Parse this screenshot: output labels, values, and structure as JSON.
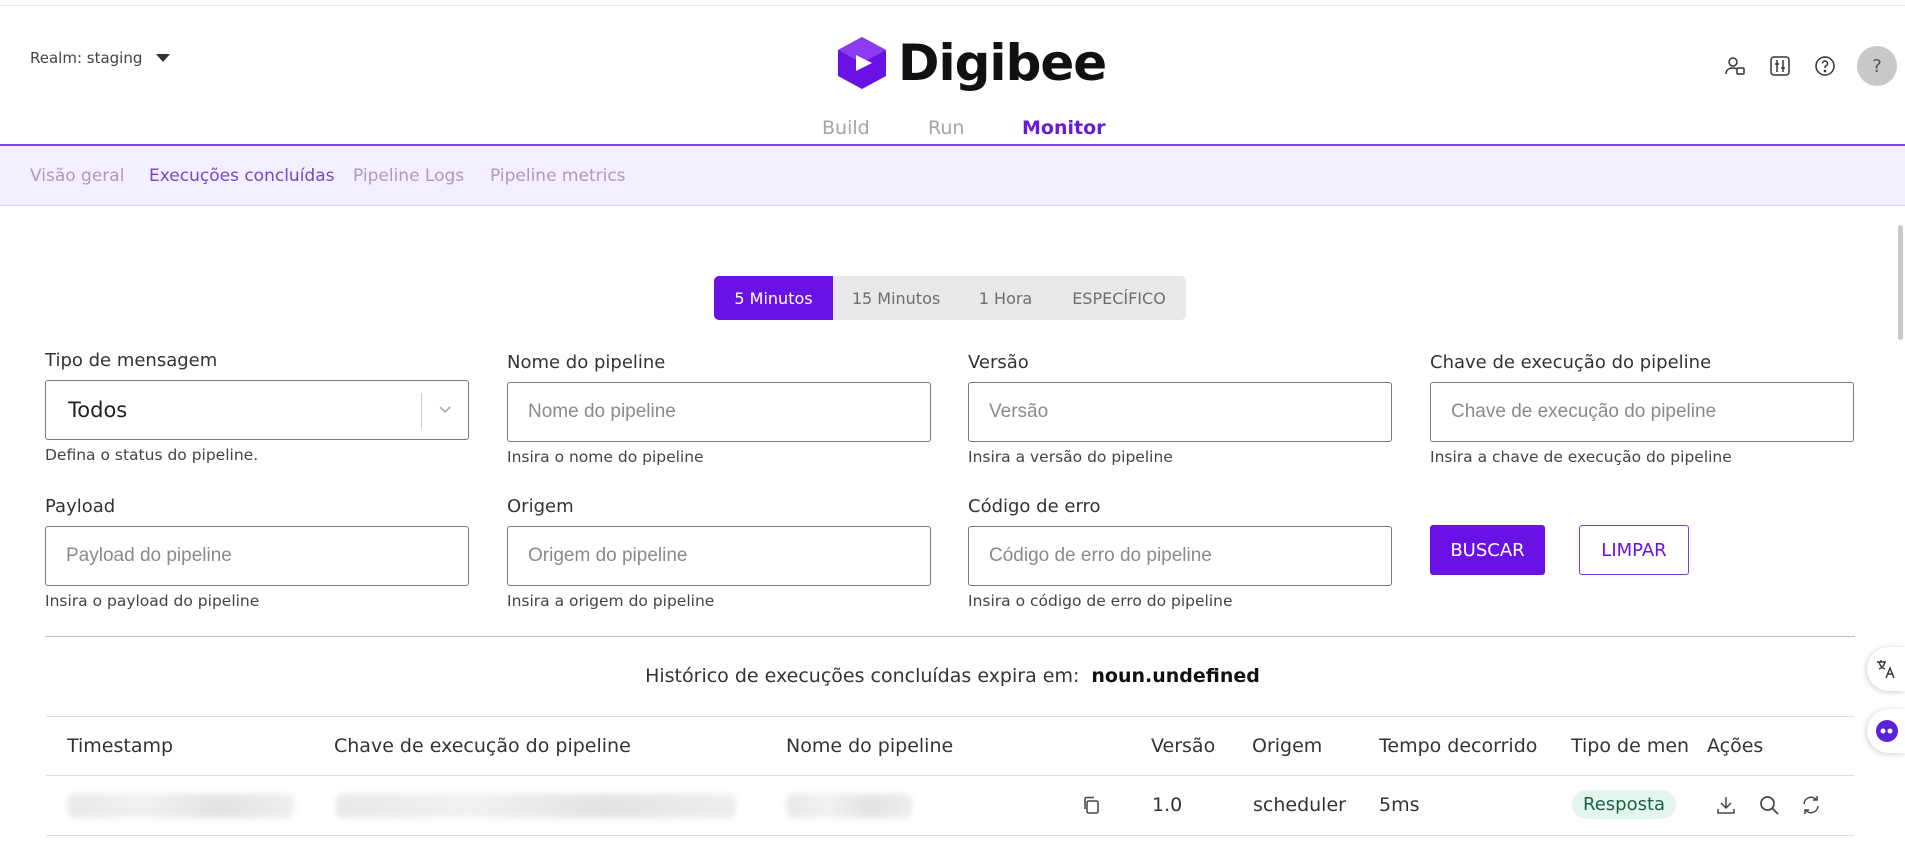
{
  "header": {
    "realm_label": "Realm: staging",
    "logo_text": "Digibee",
    "main_tabs": [
      {
        "label": "Build",
        "active": false
      },
      {
        "label": "Run",
        "active": false
      },
      {
        "label": "Monitor",
        "active": true
      }
    ],
    "icons": [
      "user-settings-icon",
      "sliders-icon",
      "help-circle-icon",
      "help-avatar-icon"
    ],
    "help_avatar_text": "?"
  },
  "subnav": [
    {
      "label": "Visão geral",
      "active": false
    },
    {
      "label": "Execuções concluídas",
      "active": true
    },
    {
      "label": "Pipeline Logs",
      "active": false
    },
    {
      "label": "Pipeline metrics",
      "active": false
    }
  ],
  "time_range": {
    "options": [
      "5 Minutos",
      "15 Minutos",
      "1 Hora",
      "ESPECÍFICO"
    ],
    "selected": "5 Minutos"
  },
  "filters": {
    "message_type": {
      "label": "Tipo de mensagem",
      "value": "Todos",
      "help": "Defina o status do pipeline."
    },
    "pipeline_name": {
      "label": "Nome do pipeline",
      "placeholder": "Nome do pipeline",
      "help": "Insira o nome do pipeline"
    },
    "version": {
      "label": "Versão",
      "placeholder": "Versão",
      "help": "Insira a versão do pipeline"
    },
    "execution_key": {
      "label": "Chave de execução do pipeline",
      "placeholder": "Chave de execução do pipeline",
      "help": "Insira a chave de execução do pipeline"
    },
    "payload": {
      "label": "Payload",
      "placeholder": "Payload do pipeline",
      "help": "Insira o payload do pipeline"
    },
    "origin": {
      "label": "Origem",
      "placeholder": "Origem do pipeline",
      "help": "Insira a origem do pipeline"
    },
    "error_code": {
      "label": "Código de erro",
      "placeholder": "Código de erro do pipeline",
      "help": "Insira o código de erro do pipeline"
    },
    "search_label": "BUSCAR",
    "clear_label": "LIMPAR"
  },
  "history": {
    "text": "Histórico de execuções concluídas expira em:",
    "value": "noun.undefined"
  },
  "table": {
    "columns": [
      "Timestamp",
      "Chave de execução do pipeline",
      "Nome do pipeline",
      "Versão",
      "Origem",
      "Tempo decorrido",
      "Tipo de mens",
      "Ações"
    ],
    "rows": [
      {
        "version": "1.0",
        "origin": "scheduler",
        "elapsed": "5ms",
        "type": "Resposta",
        "type_color": "#e3f6ee"
      }
    ]
  },
  "colors": {
    "accent": "#6a11e6",
    "subnav_bg": "#f3efff"
  }
}
